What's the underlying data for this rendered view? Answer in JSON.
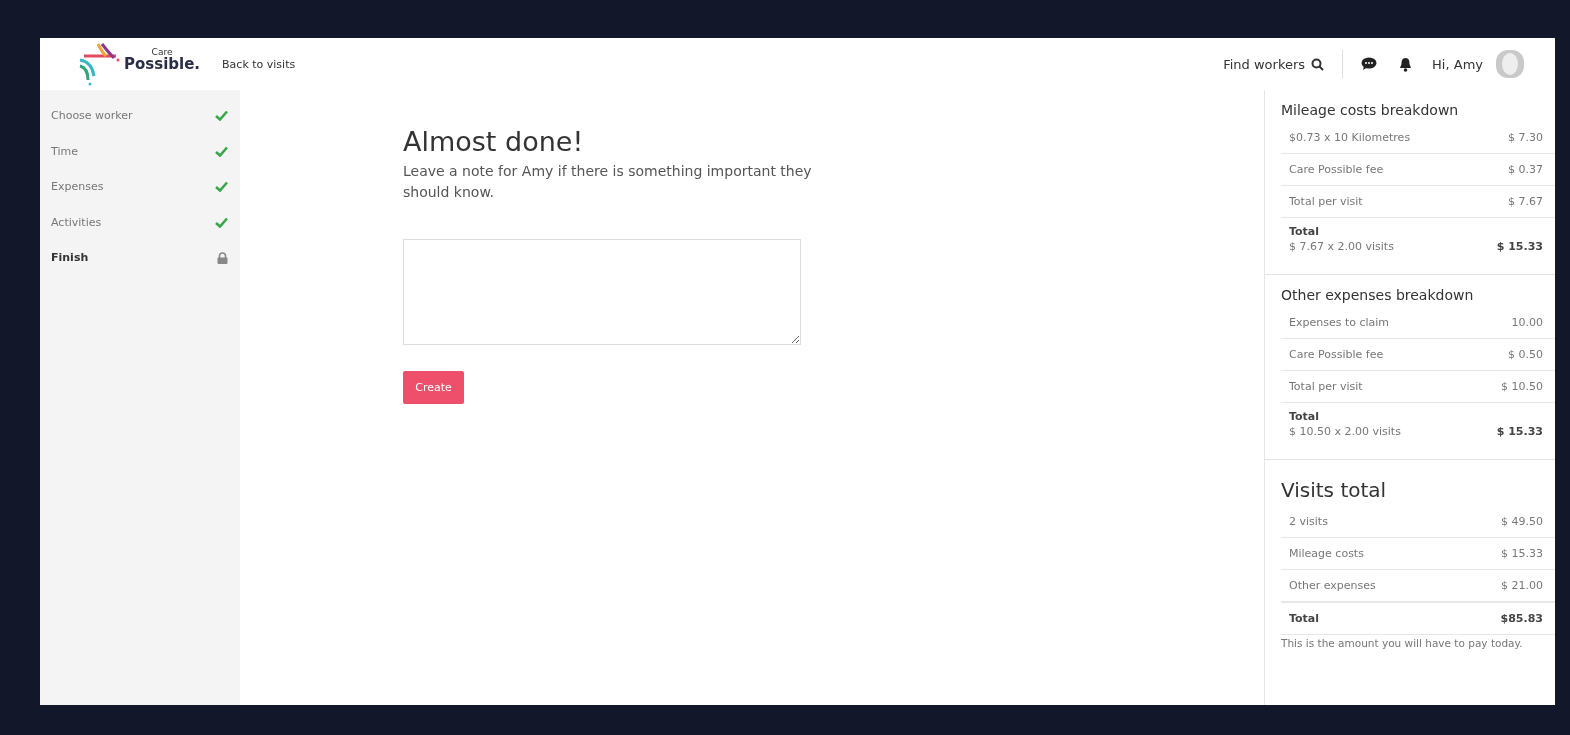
{
  "header": {
    "logo": {
      "small": "Care",
      "main": "Possible."
    },
    "back_link": "Back to visits",
    "find_workers": "Find workers",
    "greeting": "Hi, Amy"
  },
  "steps": [
    {
      "label": "Choose worker",
      "kind": "done",
      "selected": false
    },
    {
      "label": "Time",
      "kind": "done",
      "selected": false
    },
    {
      "label": "Expenses",
      "kind": "done",
      "selected": false
    },
    {
      "label": "Activities",
      "kind": "done",
      "selected": false
    },
    {
      "label": "Finish",
      "kind": "locked",
      "selected": true
    }
  ],
  "main": {
    "title": "Almost done!",
    "message": "Leave a note for Amy if there is something important they should know.",
    "create_button": "Create"
  },
  "breakdowns": [
    {
      "title": "Mileage costs breakdown",
      "rows": [
        {
          "label": "$0.73 x 10 Kilometres",
          "value": "$ 7.30"
        },
        {
          "label": "Care Possible fee",
          "value": "$ 0.37"
        },
        {
          "label": "Total per visit",
          "value": "$ 7.67"
        }
      ],
      "total": {
        "label": "Total",
        "detail": "$ 7.67 x 2.00 visits",
        "value": "$ 15.33"
      }
    },
    {
      "title": "Other expenses breakdown",
      "rows": [
        {
          "label": "Expenses to claim",
          "value": "10.00"
        },
        {
          "label": "Care Possible fee",
          "value": "$ 0.50"
        },
        {
          "label": "Total per visit",
          "value": "$ 10.50"
        }
      ],
      "total": {
        "label": "Total",
        "detail": "$ 10.50 x 2.00 visits",
        "value": "$ 15.33"
      }
    }
  ],
  "visits_total": {
    "title": "Visits total",
    "rows": [
      {
        "label": "2 visits",
        "value": "$ 49.50"
      },
      {
        "label": "Mileage costs",
        "value": "$ 15.33"
      },
      {
        "label": "Other expenses",
        "value": "$ 21.00"
      }
    ],
    "total": {
      "label": "Total",
      "value": "$85.83"
    },
    "note": "This is the amount you will have to pay today."
  }
}
